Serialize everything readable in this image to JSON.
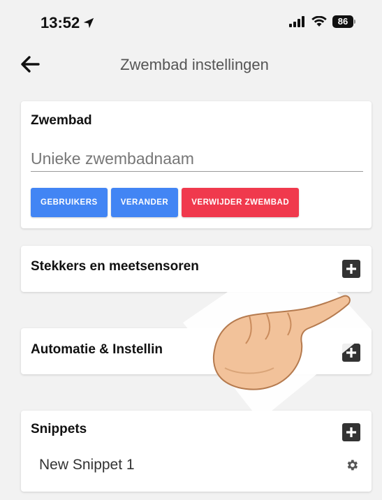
{
  "status_bar": {
    "time": "13:52",
    "battery": "86"
  },
  "header": {
    "title": "Zwembad instellingen"
  },
  "pool_card": {
    "title": "Zwembad",
    "name_placeholder": "Unieke zwembadnaam",
    "name_value": "",
    "buttons": {
      "users": "GEBRUIKERS",
      "change": "VERANDER",
      "delete": "VERWIJDER ZWEMBAD"
    }
  },
  "plugs_card": {
    "title": "Stekkers en meetsensoren"
  },
  "automation_card": {
    "title": "Automatie & Instellin"
  },
  "snippets_card": {
    "title": "Snippets",
    "items": [
      {
        "label": "New Snippet 1"
      }
    ]
  },
  "colors": {
    "primary_button": "#4285f4",
    "danger_button": "#f0394d",
    "background": "#f2f2f2",
    "card": "#ffffff"
  }
}
